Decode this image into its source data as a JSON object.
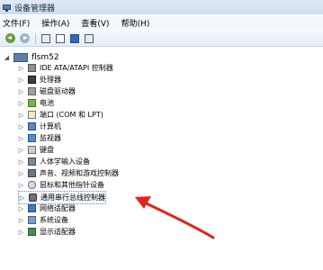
{
  "window": {
    "title": "设备管理器"
  },
  "menu": [
    {
      "name": "menu-file",
      "label": "文件(F)"
    },
    {
      "name": "menu-action",
      "label": "操作(A)"
    },
    {
      "name": "menu-view",
      "label": "查看(V)"
    },
    {
      "name": "menu-help",
      "label": "帮助(H)"
    }
  ],
  "tree": {
    "root": "flsm52",
    "items": [
      {
        "name": "ide",
        "label": "IDE ATA/ATAPI 控制器",
        "icon": "ide-controller-icon"
      },
      {
        "name": "cpu",
        "label": "处理器",
        "icon": "processor-icon"
      },
      {
        "name": "disk",
        "label": "磁盘驱动器",
        "icon": "disk-drive-icon"
      },
      {
        "name": "battery",
        "label": "电池",
        "icon": "battery-icon"
      },
      {
        "name": "ports",
        "label": "端口 (COM 和 LPT)",
        "icon": "port-icon"
      },
      {
        "name": "computer",
        "label": "计算机",
        "icon": "computer-icon"
      },
      {
        "name": "monitor",
        "label": "监视器",
        "icon": "monitor-icon"
      },
      {
        "name": "keyboard",
        "label": "键盘",
        "icon": "keyboard-icon"
      },
      {
        "name": "hid",
        "label": "人体学输入设备",
        "icon": "hid-icon"
      },
      {
        "name": "sound",
        "label": "声音、视频和游戏控制器",
        "icon": "sound-icon"
      },
      {
        "name": "mouse",
        "label": "鼠标和其他指针设备",
        "icon": "mouse-icon"
      },
      {
        "name": "usb",
        "label": "通用串行总线控制器",
        "icon": "usb-icon"
      },
      {
        "name": "network",
        "label": "网络适配器",
        "icon": "network-icon"
      },
      {
        "name": "system",
        "label": "系统设备",
        "icon": "system-device-icon"
      },
      {
        "name": "display",
        "label": "显示适配器",
        "icon": "display-adapter-icon"
      }
    ]
  },
  "annotation": {
    "color": "#e3231b"
  }
}
